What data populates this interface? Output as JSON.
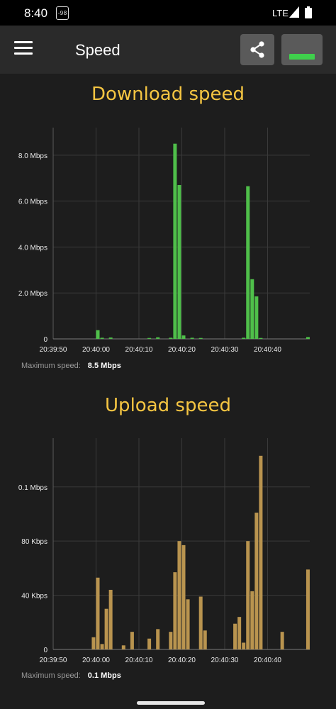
{
  "status": {
    "time": "8:40",
    "notification_badge": "-98",
    "network": "LTE"
  },
  "appbar": {
    "title": "Speed",
    "menu_icon": "hamburger-menu-icon",
    "share_icon": "share-icon",
    "toggle_indicator_color": "#3fd04c"
  },
  "download": {
    "title": "Download speed",
    "max_label": "Maximum speed:",
    "max_value": "8.5 Mbps"
  },
  "upload": {
    "title": "Upload speed",
    "max_label": "Maximum speed:",
    "max_value": "0.1 Mbps"
  },
  "chart_data": [
    {
      "type": "bar",
      "title": "Download speed",
      "color": "#4fbf4a",
      "x_tick_labels": [
        "20:39:50",
        "20:40:00",
        "20:40:10",
        "20:40:20",
        "20:40:30",
        "20:40:40"
      ],
      "y_tick_labels": [
        "0",
        "2.0 Mbps",
        "4.0 Mbps",
        "6.0 Mbps",
        "8.0 Mbps"
      ],
      "ylim": [
        0,
        9.2
      ],
      "unit": "Mbps",
      "grid": true,
      "x": [
        "20:40:00",
        "20:40:01",
        "20:40:03",
        "20:40:12",
        "20:40:14",
        "20:40:17",
        "20:40:18",
        "20:40:19",
        "20:40:20",
        "20:40:22",
        "20:40:24",
        "20:40:34",
        "20:40:35",
        "20:40:36",
        "20:40:37",
        "20:40:38",
        "20:40:49"
      ],
      "values": [
        0.38,
        0.05,
        0.06,
        0.04,
        0.07,
        0.05,
        8.5,
        6.7,
        0.15,
        0.05,
        0.04,
        0.05,
        6.65,
        2.6,
        1.85,
        0.04,
        0.08
      ]
    },
    {
      "type": "bar",
      "title": "Upload speed",
      "color": "#b9944f",
      "x_tick_labels": [
        "20:39:50",
        "20:40:00",
        "20:40:10",
        "20:40:20",
        "20:40:30",
        "20:40:40"
      ],
      "y_tick_labels": [
        "0",
        "40 Kbps",
        "80 Kbps",
        "0.1 Mbps"
      ],
      "ylim": [
        0,
        156
      ],
      "unit": "Kbps",
      "grid": true,
      "x": [
        "20:39:59",
        "20:40:00",
        "20:40:01",
        "20:40:02",
        "20:40:03",
        "20:40:06",
        "20:40:08",
        "20:40:12",
        "20:40:14",
        "20:40:17",
        "20:40:18",
        "20:40:19",
        "20:40:20",
        "20:40:21",
        "20:40:24",
        "20:40:25",
        "20:40:32",
        "20:40:33",
        "20:40:34",
        "20:40:35",
        "20:40:36",
        "20:40:37",
        "20:40:38",
        "20:40:43",
        "20:40:49"
      ],
      "values": [
        9,
        53,
        4,
        30,
        44,
        3,
        13,
        8,
        15,
        13,
        57,
        80,
        77,
        37,
        39,
        14,
        19,
        24,
        5,
        80,
        43,
        101,
        143,
        13,
        59
      ]
    }
  ]
}
